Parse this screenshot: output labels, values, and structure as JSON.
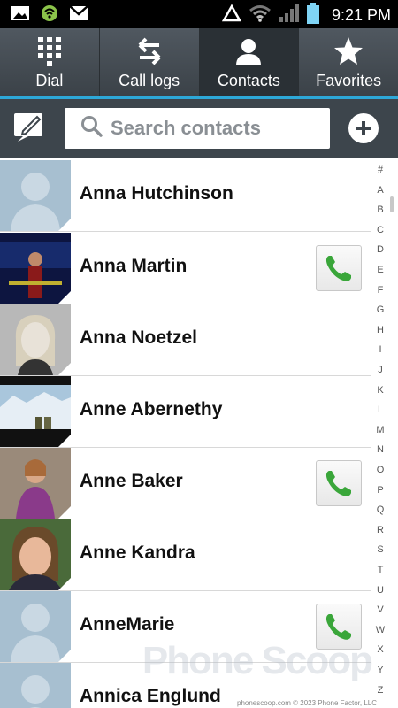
{
  "status_bar": {
    "time": "9:21 PM",
    "icons": [
      "image-notification-icon",
      "wireless-hotspot-icon",
      "gmail-icon",
      "warning-triangle-icon",
      "wifi-icon",
      "signal-icon",
      "battery-icon"
    ]
  },
  "tabs": [
    {
      "label": "Dial",
      "icon": "dialpad-icon",
      "active": false
    },
    {
      "label": "Call logs",
      "icon": "call-logs-icon",
      "active": false
    },
    {
      "label": "Contacts",
      "icon": "person-icon",
      "active": true
    },
    {
      "label": "Favorites",
      "icon": "star-icon",
      "active": false
    }
  ],
  "search": {
    "placeholder": "Search contacts"
  },
  "contacts": [
    {
      "name": "Anna Hutchinson",
      "photo": "default",
      "call_button": false
    },
    {
      "name": "Anna Martin",
      "photo": "photo",
      "call_button": true
    },
    {
      "name": "Anna Noetzel",
      "photo": "photo",
      "call_button": false
    },
    {
      "name": "Anne Abernethy",
      "photo": "photo",
      "call_button": false
    },
    {
      "name": "Anne Baker",
      "photo": "photo",
      "call_button": true
    },
    {
      "name": "Anne Kandra",
      "photo": "photo",
      "call_button": false
    },
    {
      "name": "AnneMarie",
      "photo": "default",
      "call_button": true
    },
    {
      "name": "Annica Englund",
      "photo": "default",
      "call_button": false
    }
  ],
  "index_letters": [
    "#",
    "A",
    "B",
    "C",
    "D",
    "E",
    "F",
    "G",
    "H",
    "I",
    "J",
    "K",
    "L",
    "M",
    "N",
    "O",
    "P",
    "Q",
    "R",
    "S",
    "T",
    "U",
    "V",
    "W",
    "X",
    "Y",
    "Z"
  ],
  "watermark": {
    "text": "Phone Scoop",
    "credit": "phonescoop.com  © 2023 Phone Factor, LLC"
  },
  "colors": {
    "accent": "#2da8d8",
    "tab_bg": "#3b4248",
    "call_green": "#3aa63a"
  }
}
